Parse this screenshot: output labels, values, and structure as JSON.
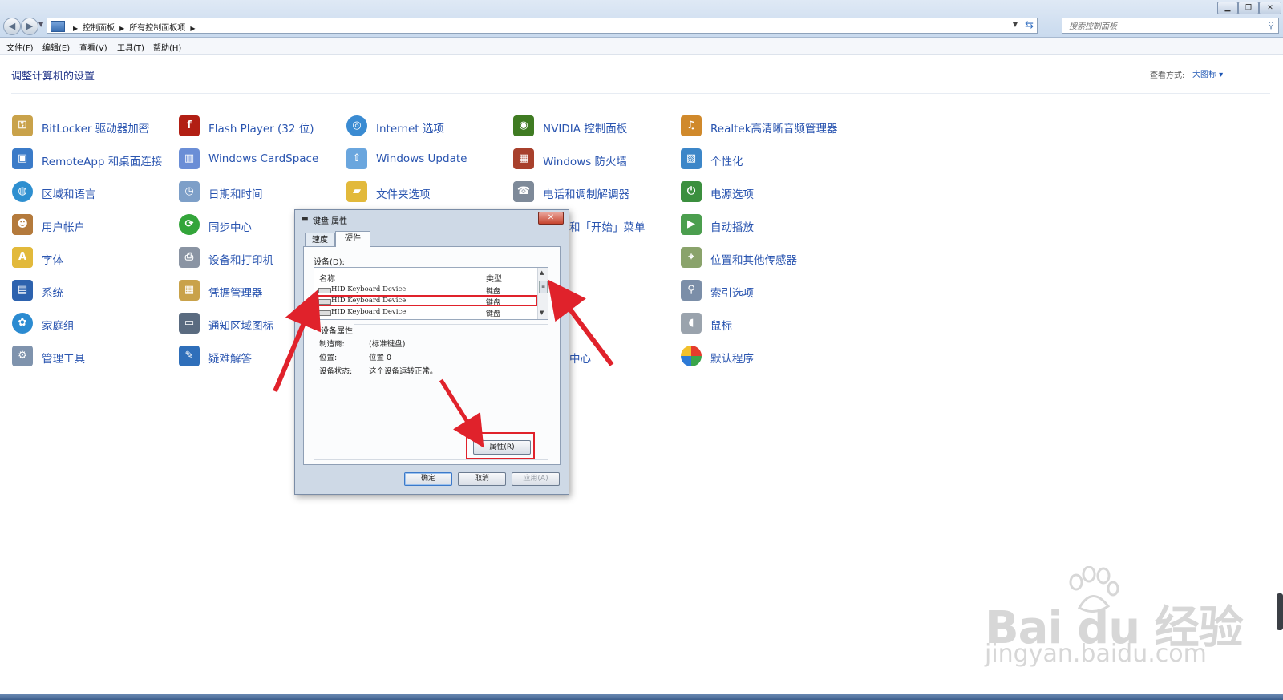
{
  "address_bar": {
    "breadcrumbs": [
      "控制面板",
      "所有控制面板项"
    ],
    "search_placeholder": "搜索控制面板"
  },
  "menu": [
    "文件(F)",
    "编辑(E)",
    "查看(V)",
    "工具(T)",
    "帮助(H)"
  ],
  "main": {
    "title": "调整计算机的设置",
    "view_by_label": "查看方式:",
    "view_by_value": "大图标 ▾"
  },
  "control_panel_items": [
    [
      "BitLocker 驱动器加密",
      "RemoteApp 和桌面连接",
      "区域和语言",
      "用户帐户",
      "字体",
      "系统",
      "家庭组",
      "管理工具"
    ],
    [
      "Flash Player (32 位)",
      "Windows CardSpace",
      "日期和时间",
      "同步中心",
      "设备和打印机",
      "凭据管理器",
      "通知区域图标",
      "疑难解答"
    ],
    [
      "Internet 选项",
      "Windows Update",
      "文件夹选项"
    ],
    [
      "NVIDIA 控制面板",
      "Windows 防火墙",
      "电话和调制解调器",
      "和「开始」菜单",
      "中心"
    ],
    [
      "Realtek高清晰音频管理器",
      "个性化",
      "电源选项",
      "自动播放",
      "位置和其他传感器",
      "索引选项",
      "鼠标",
      "默认程序"
    ]
  ],
  "dialog": {
    "title": "键盘 属性",
    "tabs": [
      "速度",
      "硬件"
    ],
    "devices_label": "设备(D):",
    "columns": [
      "名称",
      "类型"
    ],
    "devices": [
      {
        "name": "HID Keyboard Device",
        "type": "键盘"
      },
      {
        "name": "HID Keyboard Device",
        "type": "键盘"
      },
      {
        "name": "HID Keyboard Device",
        "type": "键盘"
      }
    ],
    "props_title": "设备属性",
    "props": [
      {
        "key": "制造商:",
        "value": "(标准键盘)"
      },
      {
        "key": "位置:",
        "value": "位置 0"
      },
      {
        "key": "设备状态:",
        "value": "这个设备运转正常。"
      }
    ],
    "properties_button": "属性(R)",
    "ok": "确定",
    "cancel": "取消",
    "apply": "应用(A)"
  },
  "watermark": {
    "logo": "Bai  du 经验",
    "url": "jingyan.baidu.com"
  },
  "icons": [
    "back-arrow",
    "forward-arrow",
    "refresh",
    "search",
    "close"
  ],
  "colors": {
    "link": "#2a55b0",
    "title": "#1e3287",
    "highlight": "#e0222b"
  }
}
